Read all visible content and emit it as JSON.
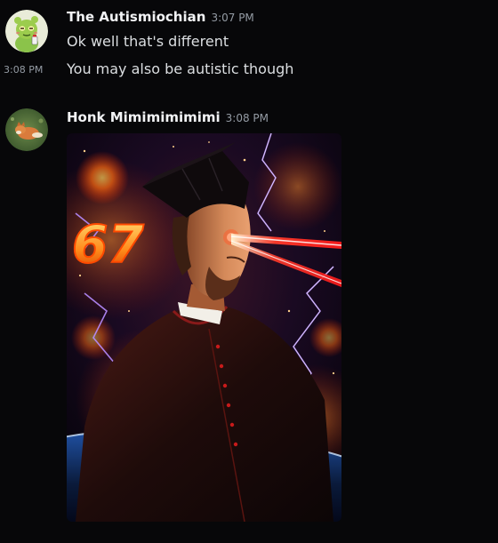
{
  "messages": [
    {
      "author": "The Autismiochian",
      "time": "3:07 PM",
      "lines": [
        {
          "text": "Ok well that's different",
          "side_time": ""
        },
        {
          "text": "You may also be autistic though",
          "side_time": "3:08 PM"
        }
      ]
    },
    {
      "author": "Honk Mimimimimimi",
      "time": "3:08 PM",
      "attachment": {
        "overlay_text": "67"
      }
    }
  ],
  "colors": {
    "background": "#070709",
    "author": "#f2f3f5",
    "text": "#dbdee1",
    "timestamp": "#949ba4",
    "avatar1_bg": "#e9ecd9",
    "avatar2_bg": "#4a6b3c"
  },
  "icons": {
    "avatar1": "green-cartoon-character-avatar",
    "avatar2": "fox-photo-avatar"
  }
}
